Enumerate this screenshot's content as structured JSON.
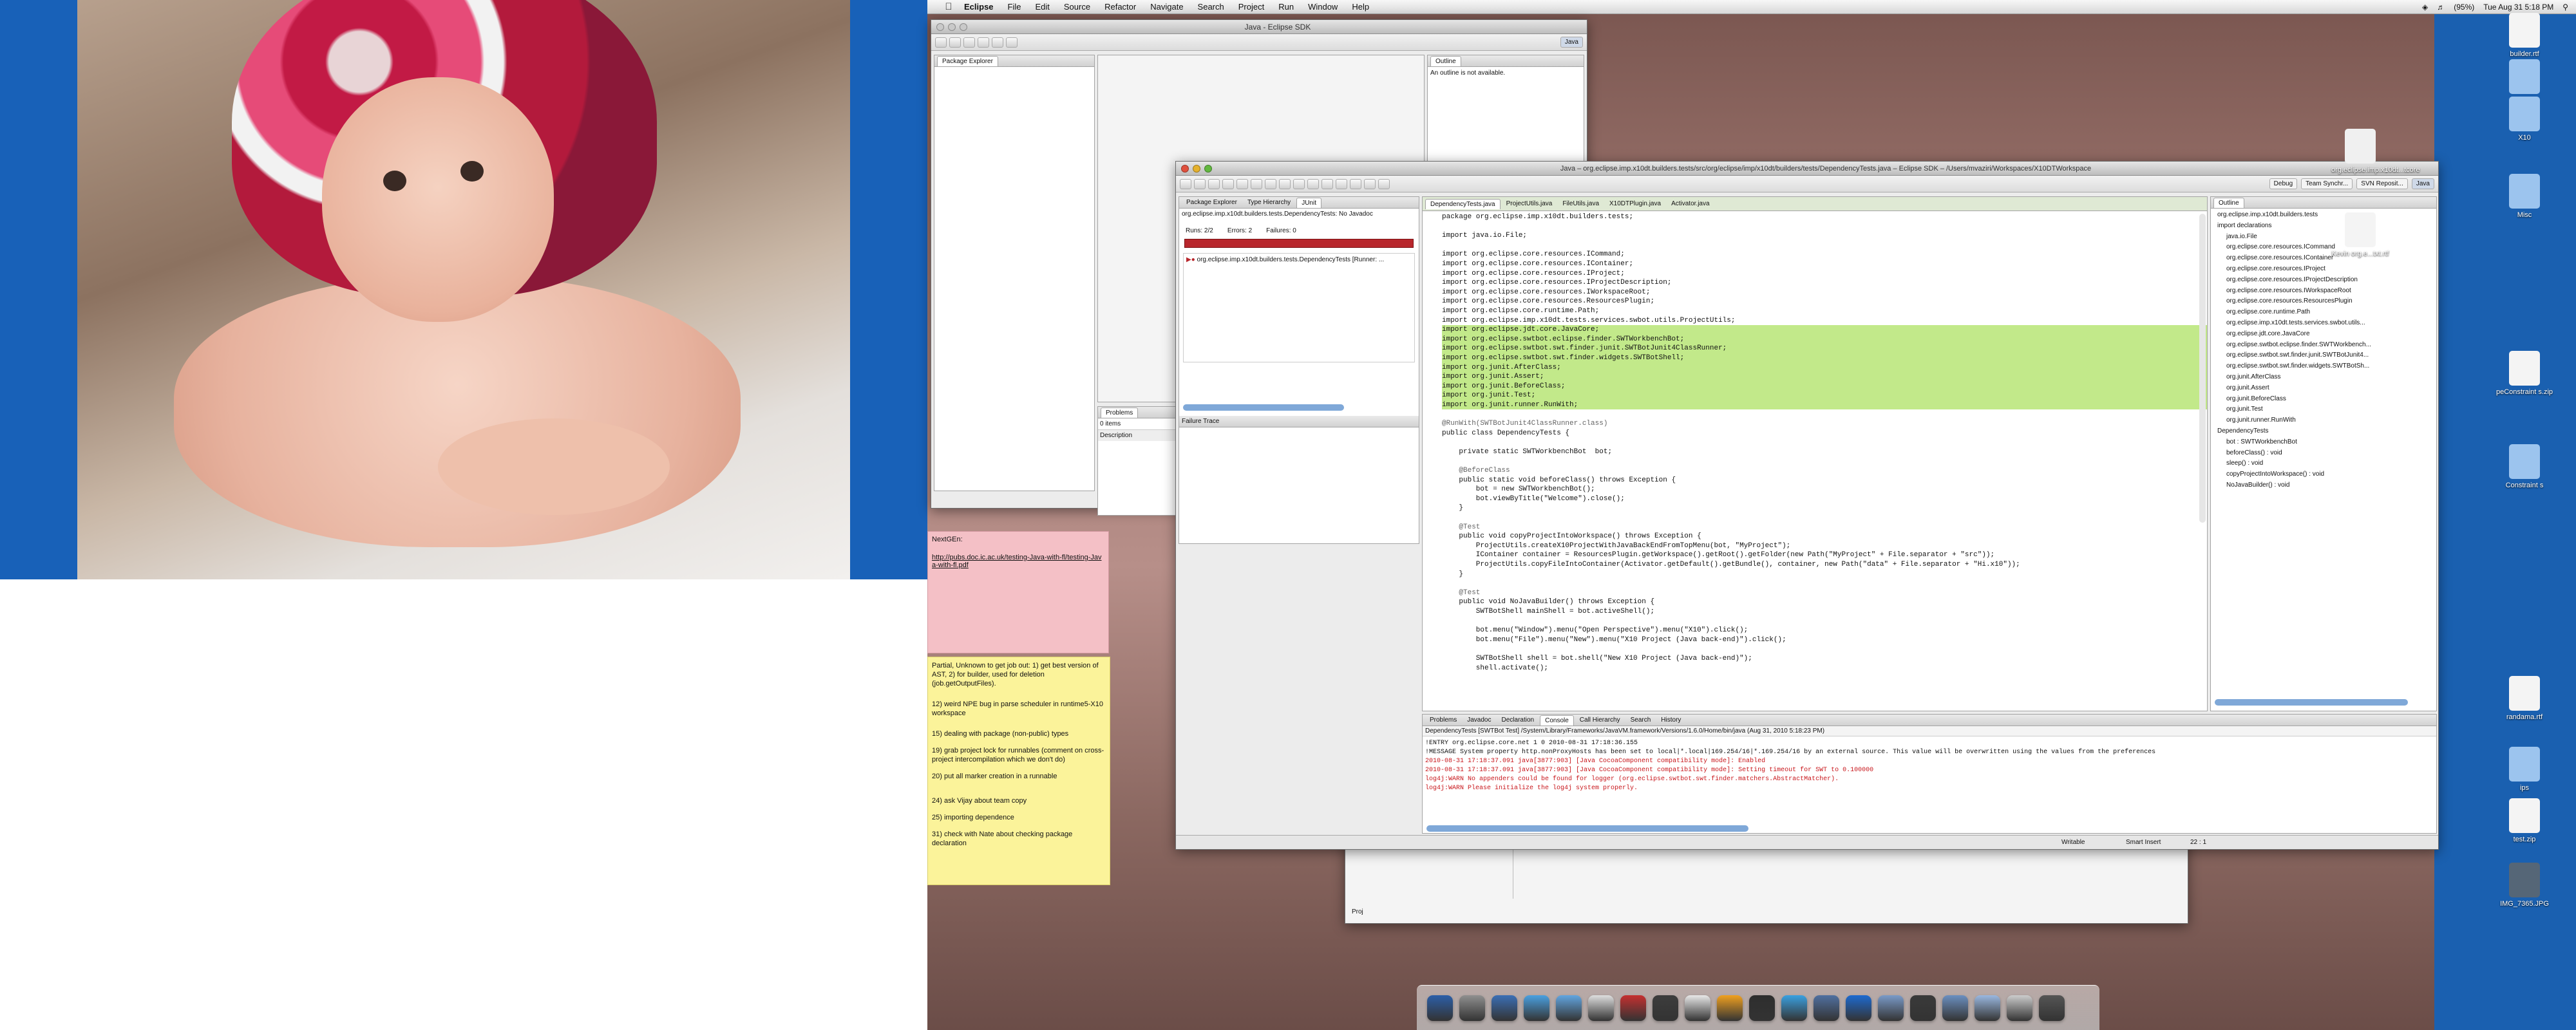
{
  "menubar": {
    "app": "Eclipse",
    "items": [
      "File",
      "Edit",
      "Source",
      "Refactor",
      "Navigate",
      "Search",
      "Project",
      "Run",
      "Window",
      "Help"
    ],
    "battery": "(95%)",
    "clock": "Tue Aug 31  5:18 PM"
  },
  "back_window": {
    "title": "Java - Eclipse SDK",
    "perspective": "Java",
    "package_explorer_tab": "Package Explorer",
    "outline_tab": "Outline",
    "outline_message": "An outline is not available.",
    "problems_tab": "Problems",
    "problems_count": "0 items",
    "problems_col": "Description",
    "bottom_label": "Proj"
  },
  "main_window": {
    "title": "Java – org.eclipse.imp.x10dt.builders.tests/src/org/eclipse/imp/x10dt/builders/tests/DependencyTests.java – Eclipse SDK – /Users/mvaziri/Workspaces/X10DTWorkspace",
    "perspectives": [
      "Debug",
      "Team Synchr...",
      "SVN Reposit...",
      "Java"
    ],
    "left_tabs": [
      "Package Explorer",
      "Type Hierarchy",
      "JUnit"
    ],
    "junit": {
      "header": "org.eclipse.imp.x10dt.builders.tests.DependencyTests: No Javadoc",
      "runs": "Runs:  2/2",
      "errors": "Errors:  2",
      "failures": "Failures:  0",
      "tree_item": "org.eclipse.imp.x10dt.builders.tests.DependencyTests [Runner: ...",
      "failure_trace": "Failure Trace"
    },
    "editor_tabs": [
      "DependencyTests.java",
      "ProjectUtils.java",
      "FileUtils.java",
      "X10DTPlugin.java",
      "Activator.java"
    ],
    "code_lines": [
      "package org.eclipse.imp.x10dt.builders.tests;",
      "",
      "import java.io.File;",
      "",
      "import org.eclipse.core.resources.ICommand;",
      "import org.eclipse.core.resources.IContainer;",
      "import org.eclipse.core.resources.IProject;",
      "import org.eclipse.core.resources.IProjectDescription;",
      "import org.eclipse.core.resources.IWorkspaceRoot;",
      "import org.eclipse.core.resources.ResourcesPlugin;",
      "import org.eclipse.core.runtime.Path;",
      "import org.eclipse.imp.x10dt.tests.services.swbot.utils.ProjectUtils;",
      "import org.eclipse.jdt.core.JavaCore;",
      "import org.eclipse.swtbot.eclipse.finder.SWTWorkbenchBot;",
      "import org.eclipse.swtbot.swt.finder.junit.SWTBotJunit4ClassRunner;",
      "import org.eclipse.swtbot.swt.finder.widgets.SWTBotShell;",
      "import org.junit.AfterClass;",
      "import org.junit.Assert;",
      "import org.junit.BeforeClass;",
      "import org.junit.Test;",
      "import org.junit.runner.RunWith;",
      "",
      "@RunWith(SWTBotJunit4ClassRunner.class)",
      "public class DependencyTests {",
      "",
      "    private static SWTWorkbenchBot  bot;",
      "",
      "    @BeforeClass",
      "    public static void beforeClass() throws Exception {",
      "        bot = new SWTWorkbenchBot();",
      "        bot.viewByTitle(\"Welcome\").close();",
      "    }",
      "",
      "    @Test",
      "    public void copyProjectIntoWorkspace() throws Exception {",
      "        ProjectUtils.createX10ProjectWithJavaBackEndFromTopMenu(bot, \"MyProject\");",
      "        IContainer container = ResourcesPlugin.getWorkspace().getRoot().getFolder(new Path(\"MyProject\" + File.separator + \"src\"));",
      "        ProjectUtils.copyFileIntoContainer(Activator.getDefault().getBundle(), container, new Path(\"data\" + File.separator + \"Hi.x10\"));",
      "    }",
      "",
      "    @Test",
      "    public void NoJavaBuilder() throws Exception {",
      "        SWTBotShell mainShell = bot.activeShell();",
      "",
      "        bot.menu(\"Window\").menu(\"Open Perspective\").menu(\"X10\").click();",
      "        bot.menu(\"File\").menu(\"New\").menu(\"X10 Project (Java back-end)\").click();",
      "",
      "        SWTBotShell shell = bot.shell(\"New X10 Project (Java back-end)\");",
      "        shell.activate();"
    ],
    "outline_tab": "Outline",
    "outline_items": [
      "org.eclipse.imp.x10dt.builders.tests",
      "import declarations",
      "java.io.File",
      "org.eclipse.core.resources.ICommand",
      "org.eclipse.core.resources.IContainer",
      "org.eclipse.core.resources.IProject",
      "org.eclipse.core.resources.IProjectDescription",
      "org.eclipse.core.resources.IWorkspaceRoot",
      "org.eclipse.core.resources.ResourcesPlugin",
      "org.eclipse.core.runtime.Path",
      "org.eclipse.imp.x10dt.tests.services.swbot.utils...",
      "org.eclipse.jdt.core.JavaCore",
      "org.eclipse.swtbot.eclipse.finder.SWTWorkbench...",
      "org.eclipse.swtbot.swt.finder.junit.SWTBotJunit4...",
      "org.eclipse.swtbot.swt.finder.widgets.SWTBotSh...",
      "org.junit.AfterClass",
      "org.junit.Assert",
      "org.junit.BeforeClass",
      "org.junit.Test",
      "org.junit.runner.RunWith",
      "DependencyTests",
      "bot : SWTWorkbenchBot",
      "beforeClass() : void",
      "sleep() : void",
      "copyProjectIntoWorkspace() : void",
      "NoJavaBuilder() : void"
    ],
    "bottom_tabs": [
      "Problems",
      "Javadoc",
      "Declaration",
      "Console",
      "Call Hierarchy",
      "Search",
      "History"
    ],
    "console_header": "DependencyTests [SWTBot Test] /System/Library/Frameworks/JavaVM.framework/Versions/1.6.0/Home/bin/java (Aug 31, 2010 5:18:23 PM)",
    "console_lines": [
      {
        "text": "!ENTRY org.eclipse.core.net 1 0 2010-08-31 17:18:36.155",
        "color": "#111111"
      },
      {
        "text": "!MESSAGE System property http.nonProxyHosts has been set to local|*.local|169.254/16|*.169.254/16 by an external source. This value will be overwritten using the values from the preferences",
        "color": "#111111"
      },
      {
        "text": "2010-08-31 17:18:37.091 java[3877:903] [Java CocoaComponent compatibility mode]: Enabled",
        "color": "#c8161b"
      },
      {
        "text": "2010-08-31 17:18:37.091 java[3877:903] [Java CocoaComponent compatibility mode]: Setting timeout for SWT to 0.100000",
        "color": "#c8161b"
      },
      {
        "text": "log4j:WARN No appenders could be found for logger (org.eclipse.swtbot.swt.finder.matchers.AbstractMatcher).",
        "color": "#c8161b"
      },
      {
        "text": "log4j:WARN Please initialize the log4j system properly.",
        "color": "#c8161b"
      }
    ],
    "status": {
      "writable": "Writable",
      "insert": "Smart Insert",
      "position": "22 : 1"
    }
  },
  "notes": {
    "pink_title": "NextGEn:",
    "pink_link": "http://pubs.doc.ic.ac.uk/testing-Java-with-fl/testing-Java-with-fl.pdf",
    "yellow_lines": [
      "Partial, Unknown to get job out: 1) get best version of AST, 2) for builder, used for deletion (job.getOutputFiles).",
      "12) weird NPE bug in parse scheduler in runtime5-X10 workspace",
      "15) dealing with package (non-public) types",
      "19) grab project lock for runnables (comment on cross-project intercompilation which we don't do)",
      "20) put all marker creation in a runnable",
      "24) ask Vijay about team copy",
      "25) importing dependence",
      "31) check with Nate about checking package declaration"
    ]
  },
  "desktop_icons": [
    {
      "label": "builder.rtf",
      "color": "#f4f4f4"
    },
    {
      "label": "Alex",
      "color": "#9cc4ee"
    },
    {
      "label": "X10",
      "color": "#9cc4ee"
    },
    {
      "label": "org.eclipse.imp.x10dt...tcore",
      "color": "#f0f0f0"
    },
    {
      "label": "Misc",
      "color": "#9cc4ee"
    },
    {
      "label": "Kevin org.e...txt.rtf",
      "color": "#f4f4f4"
    },
    {
      "label": "peConstraint s.zip",
      "color": "#f4f4f4"
    },
    {
      "label": "Constraint s",
      "color": "#9cc4ee"
    },
    {
      "label": "randama.rtf",
      "color": "#f4f4f4"
    },
    {
      "label": "ips",
      "color": "#9cc4ee"
    },
    {
      "label": "test.zip",
      "color": "#f4f4f4"
    },
    {
      "label": "IMG_7365.JPG",
      "color": "#556677"
    }
  ],
  "dock_colors": [
    "#2c5fa8",
    "#8f8f8f",
    "#3b6fb5",
    "#4aa0e0",
    "#62a5e0",
    "#dedede",
    "#c53030",
    "#3d3d3d",
    "#e8e8e8",
    "#f0a020",
    "#2e2e2e",
    "#3aa0e0",
    "#5070a0",
    "#1d6ad0",
    "#7a9ac8",
    "#3a3a3a",
    "#6b8fc0",
    "#9ab8e0",
    "#cccccc",
    "#555555"
  ]
}
